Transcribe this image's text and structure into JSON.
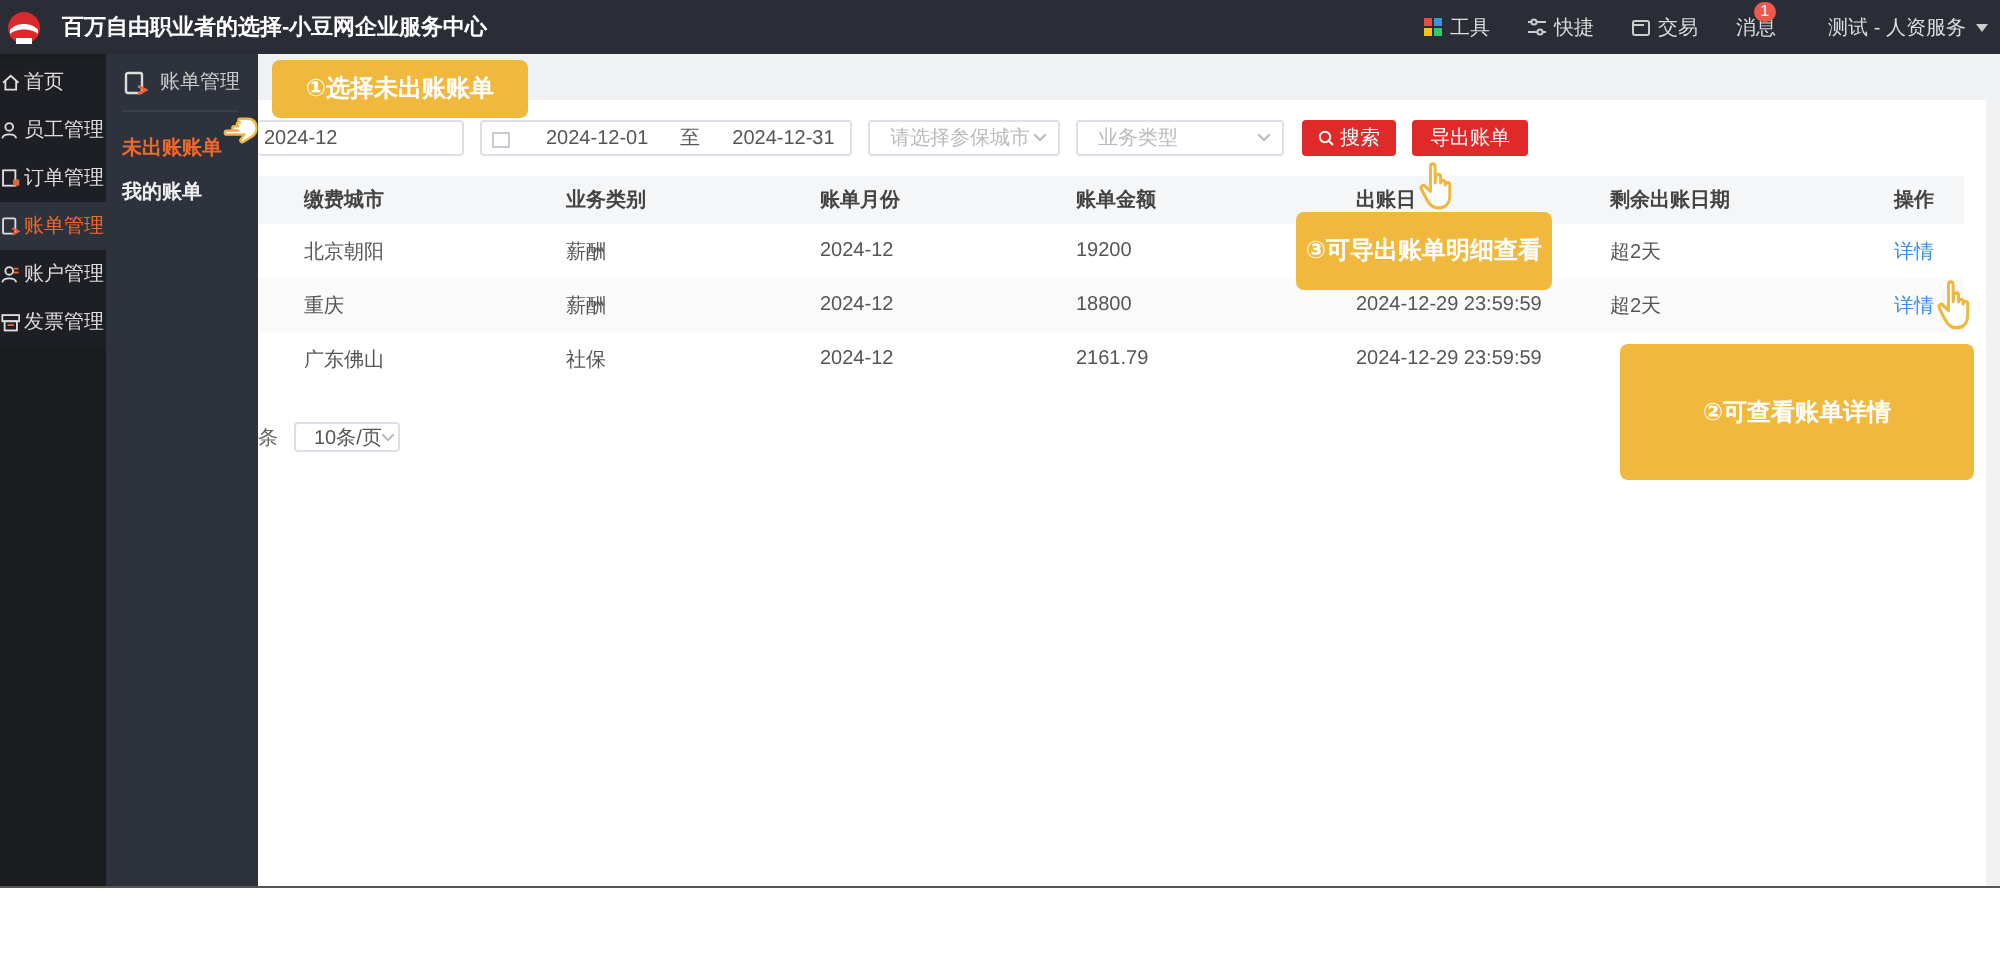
{
  "header": {
    "title": "百万自由职业者的选择-小豆网企业服务中心",
    "tools": [
      {
        "kind": "tools",
        "label": "工具"
      },
      {
        "kind": "shortcut",
        "label": "快捷"
      },
      {
        "kind": "trade",
        "label": "交易"
      },
      {
        "kind": "messages",
        "label": "消息",
        "badge": "1"
      }
    ],
    "user": "测试 - 人资服务"
  },
  "sidebar": {
    "items": [
      {
        "kind": "home",
        "label": "首页",
        "selected": false
      },
      {
        "kind": "staff",
        "label": "员工管理",
        "selected": false
      },
      {
        "kind": "order",
        "label": "订单管理",
        "selected": false
      },
      {
        "kind": "bill",
        "label": "账单管理",
        "selected": true
      },
      {
        "kind": "account",
        "label": "账户管理",
        "selected": false
      },
      {
        "kind": "invoice",
        "label": "发票管理",
        "selected": false
      }
    ]
  },
  "subnav": {
    "title": "账单管理",
    "items": [
      {
        "label": "未出账账单",
        "selected": true
      },
      {
        "label": "我的账单",
        "selected": false
      }
    ]
  },
  "filters": {
    "month": "2024-12",
    "date_start": "2024-12-01",
    "date_separator": "至",
    "date_end": "2024-12-31",
    "city_placeholder": "请选择参保城市",
    "type_placeholder": "业务类型",
    "search_button": "搜索",
    "export_button": "导出账单"
  },
  "table": {
    "columns": [
      "缴费城市",
      "业务类别",
      "账单月份",
      "账单金额",
      "出账日",
      "剩余出账日期",
      "操作"
    ],
    "rows": [
      {
        "cells": [
          "北京朝阳",
          "薪酬",
          "2024-12",
          "19200",
          null,
          "超2天",
          "详情"
        ]
      },
      {
        "cells": [
          "重庆",
          "薪酬",
          "2024-12",
          "18800",
          "2024-12-29 23:59:59",
          "超2天",
          "详情"
        ]
      },
      {
        "cells": [
          "广东佛山",
          "社保",
          "2024-12",
          "2161.79",
          "2024-12-29 23:59:59",
          null,
          null
        ]
      }
    ]
  },
  "pagination": {
    "total": "条",
    "page_size": "10条/页"
  },
  "callouts": [
    {
      "text": "①选择未出账账单"
    },
    {
      "text": "③可导出账单明细查看"
    },
    {
      "text": "②可查看账单详情"
    }
  ]
}
